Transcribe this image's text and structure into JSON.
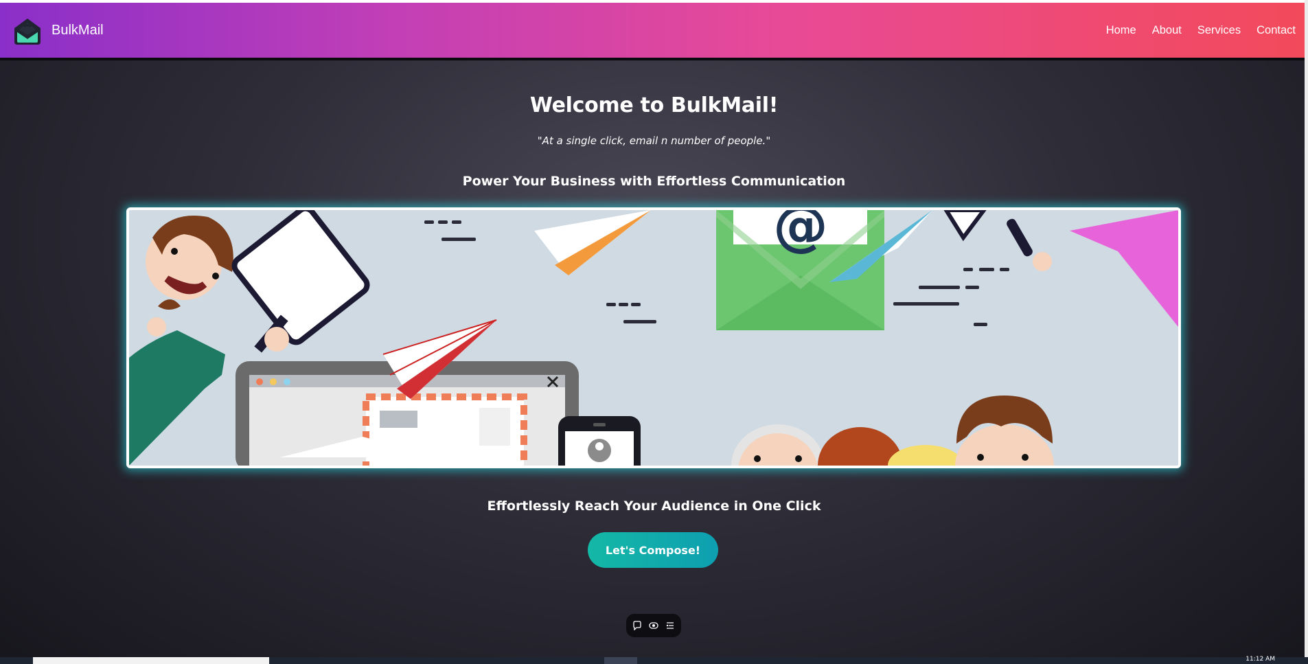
{
  "brand": {
    "name": "BulkMail",
    "logo_icon": "envelope-logo-icon"
  },
  "nav": {
    "items": [
      {
        "label": "Home"
      },
      {
        "label": "About"
      },
      {
        "label": "Services"
      },
      {
        "label": "Contact"
      }
    ]
  },
  "hero": {
    "title": "Welcome to BulkMail!",
    "quote": "\"At a single click, email n number of people.\"",
    "subtitle": "Power Your Business with Effortless Communication",
    "tagline": "Effortlessly Reach Your Audience in One Click",
    "cta_label": "Let's Compose!"
  },
  "toolbar": {
    "icons": [
      "chat-bubble-icon",
      "toggle-view-icon",
      "list-settings-icon"
    ]
  },
  "taskbar": {
    "time": "11:12 AM"
  },
  "colors": {
    "nav_gradient_start": "#8a2fc9",
    "nav_gradient_end": "#f24a5a",
    "cta": "#14b8a6",
    "banner_glow": "#28c8d2"
  }
}
